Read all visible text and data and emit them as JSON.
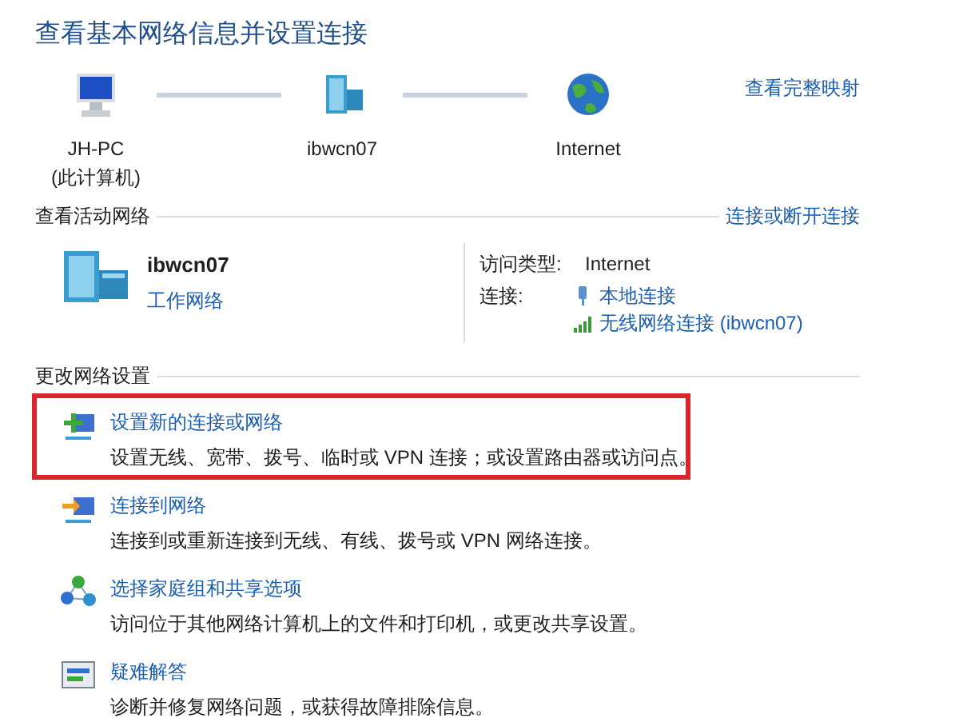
{
  "title": "查看基本网络信息并设置连接",
  "map": {
    "nodes": [
      {
        "kind": "computer",
        "label": "JH-PC",
        "sublabel": "(此计算机)"
      },
      {
        "kind": "network",
        "label": "ibwcn07"
      },
      {
        "kind": "internet",
        "label": "Internet"
      }
    ],
    "full_map_link": "查看完整映射"
  },
  "active_networks": {
    "heading": "查看活动网络",
    "link": "连接或断开连接",
    "network": {
      "name": "ibwcn07",
      "type_link": "工作网络"
    },
    "access_type_label": "访问类型:",
    "access_type": "Internet",
    "connections_label": "连接:",
    "connections": [
      {
        "kind": "wired",
        "label": "本地连接"
      },
      {
        "kind": "wireless",
        "label": "无线网络连接 (ibwcn07)"
      }
    ]
  },
  "change_settings": {
    "heading": "更改网络设置",
    "tasks": [
      {
        "kind": "new-connection",
        "title": "设置新的连接或网络",
        "description": "设置无线、宽带、拨号、临时或 VPN 连接；或设置路由器或访问点。",
        "highlighted": true
      },
      {
        "kind": "connect",
        "title": "连接到网络",
        "description": "连接到或重新连接到无线、有线、拨号或 VPN 网络连接。",
        "highlighted": false
      },
      {
        "kind": "homegroup",
        "title": "选择家庭组和共享选项",
        "description": "访问位于其他网络计算机上的文件和打印机，或更改共享设置。",
        "highlighted": false
      },
      {
        "kind": "troubleshoot",
        "title": "疑难解答",
        "description": "诊断并修复网络问题，或获得故障排除信息。",
        "highlighted": false
      }
    ]
  }
}
